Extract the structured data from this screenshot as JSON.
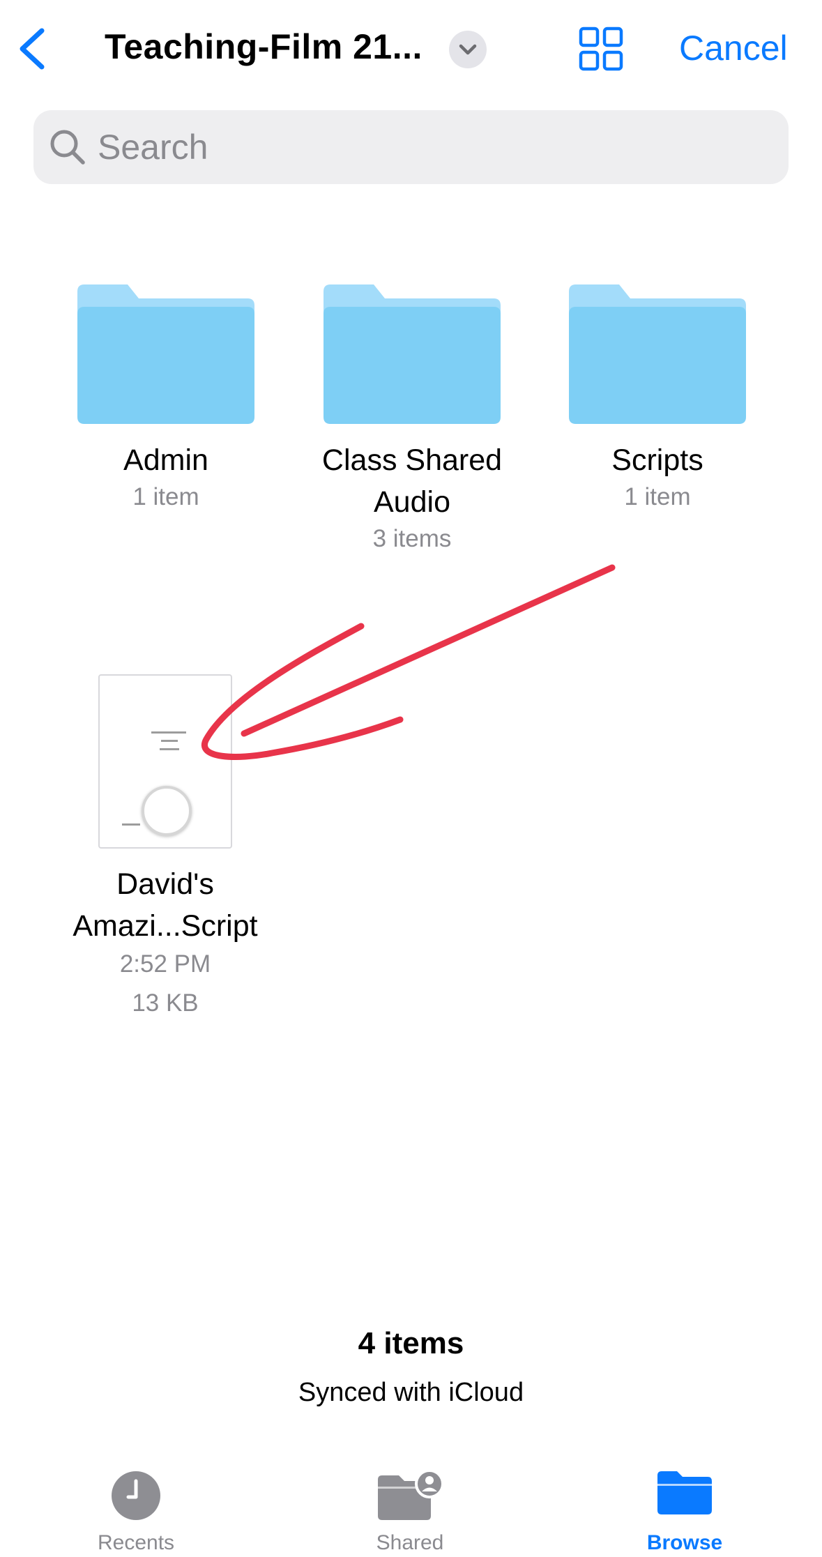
{
  "header": {
    "title": "Teaching-Film 21...",
    "cancel_label": "Cancel"
  },
  "search": {
    "placeholder": "Search",
    "value": ""
  },
  "folders": [
    {
      "name": "Admin",
      "meta": "1 item"
    },
    {
      "name_line1": "Class Shared",
      "name_line2": "Audio",
      "meta": "3 items"
    },
    {
      "name": "Scripts",
      "meta": "1 item"
    }
  ],
  "document": {
    "name_line1": "David's",
    "name_line2": "Amazi...Script",
    "time": "2:52 PM",
    "size": "13 KB"
  },
  "footer": {
    "count": "4 items",
    "sync_status": "Synced with iCloud"
  },
  "tabs": [
    {
      "label": "Recents",
      "icon": "clock-icon"
    },
    {
      "label": "Shared",
      "icon": "shared-folder-icon"
    },
    {
      "label": "Browse",
      "icon": "folder-icon",
      "active": true
    }
  ],
  "colors": {
    "accent": "#0a7aff",
    "folder_front": "#7ecff5",
    "folder_back": "#a3dcfa",
    "annotation": "#e8344a",
    "secondary_text": "#8a8a8f"
  }
}
